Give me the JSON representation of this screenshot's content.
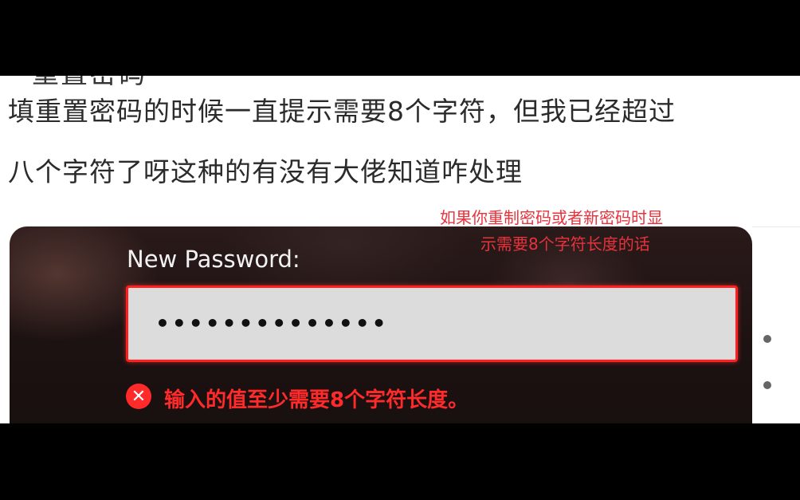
{
  "post": {
    "clipped_text": "重置密码",
    "line1": "填重置密码的时候一直提示需要8个字符，但我已经超过",
    "line2": "八个字符了呀这种的有没有大佬知道咋处理"
  },
  "annotation": {
    "line1": "如果你重制密码或者新密码时显",
    "line2": "示需要8个字符长度的话"
  },
  "form": {
    "label": "New Password:",
    "value_masked": "••••••••••••••",
    "error_icon": "x-circle-icon",
    "error_text": "输入的值至少需要8个字符长度。"
  },
  "colors": {
    "error": "#ff2a2a",
    "annotation": "#e8323c",
    "input_bg": "#dcdcdc"
  }
}
